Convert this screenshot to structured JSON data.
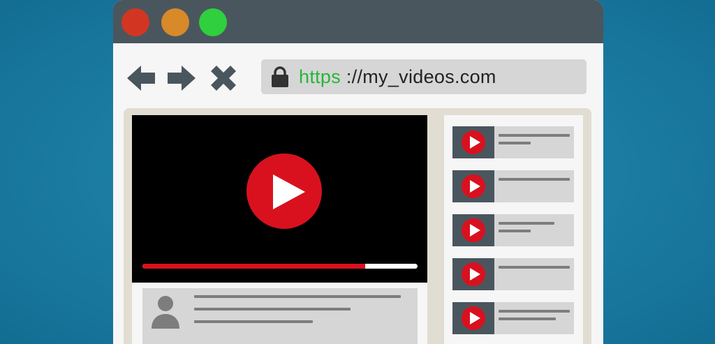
{
  "window": {
    "controls": [
      "close",
      "minimize",
      "maximize"
    ],
    "colors": {
      "close": "#d23622",
      "minimize": "#d8892a",
      "maximize": "#2fcf3e",
      "titlebar": "#4a565e"
    }
  },
  "toolbar": {
    "nav_icons": [
      "back-arrow-icon",
      "forward-arrow-icon",
      "stop-icon"
    ],
    "address": {
      "icon": "lock-icon",
      "scheme": "https",
      "rest": " ://my_videos.com",
      "scheme_color": "#27b53a"
    }
  },
  "player": {
    "icon": "play-icon",
    "progress": 0.81,
    "accent": "#d9111f"
  },
  "channel": {
    "avatar_icon": "user-avatar-icon"
  },
  "sidebar": {
    "items": [
      {
        "thumb_icon": "play-icon"
      },
      {
        "thumb_icon": "play-icon"
      },
      {
        "thumb_icon": "play-icon"
      },
      {
        "thumb_icon": "play-icon"
      },
      {
        "thumb_icon": "play-icon"
      }
    ]
  }
}
